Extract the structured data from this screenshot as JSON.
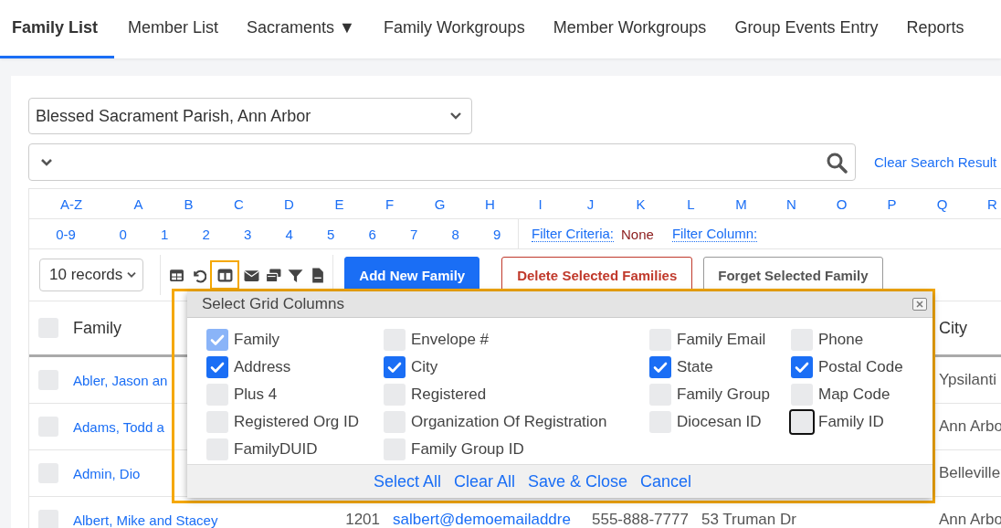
{
  "tabs": [
    {
      "label": "Family List",
      "selected": true
    },
    {
      "label": "Member List",
      "selected": false
    },
    {
      "label": "Sacraments ▼",
      "selected": false
    },
    {
      "label": "Family Workgroups",
      "selected": false
    },
    {
      "label": "Member Workgroups",
      "selected": false
    },
    {
      "label": "Group Events Entry",
      "selected": false
    },
    {
      "label": "Reports",
      "selected": false
    }
  ],
  "parish_select": {
    "value": "Blessed Sacrament Parish, Ann Arbor"
  },
  "clear_search": "Clear Search Result",
  "letters": [
    "A-Z",
    "A",
    "B",
    "C",
    "D",
    "E",
    "F",
    "G",
    "H",
    "I",
    "J",
    "K",
    "L",
    "M",
    "N",
    "O",
    "P",
    "Q",
    "R"
  ],
  "digits": [
    "0-9",
    "0",
    "1",
    "2",
    "3",
    "4",
    "5",
    "6",
    "7",
    "8",
    "9"
  ],
  "filter_criteria": {
    "label": "Filter Criteria:",
    "value": "None"
  },
  "filter_column": {
    "label": "Filter Column:"
  },
  "records_select": {
    "value": "10 records"
  },
  "tools": [
    {
      "highlighted": false
    },
    {
      "highlighted": false
    },
    {
      "highlighted": true
    },
    {
      "highlighted": false
    },
    {
      "highlighted": false
    },
    {
      "highlighted": false
    },
    {
      "highlighted": false
    }
  ],
  "buttons": [
    {
      "label": "Add New Family",
      "kind": "primary"
    },
    {
      "label": "Delete Selected Families",
      "kind": "danger"
    },
    {
      "label": "Forget Selected Family",
      "kind": "plain"
    }
  ],
  "table": {
    "select_all_checked": false,
    "columns": [
      "Family",
      "City"
    ],
    "rows": [
      {
        "checked": false,
        "family": "Abler, Jason an",
        "city": "Ypsilanti"
      },
      {
        "checked": false,
        "family": "Adams, Todd a",
        "city": "Ann Arbo"
      },
      {
        "checked": false,
        "family": "Admin, Dio",
        "city": "Belleville"
      },
      {
        "checked": false,
        "family": "Albert, Mike and Stacey",
        "column_3": "1201",
        "column_4": "salbert@demoemailaddre",
        "column_5": "555-888-7777",
        "column_6": "53 Truman Dr",
        "city": "Ann Arbo"
      }
    ]
  },
  "popup": {
    "title": "Select Grid Columns",
    "columns": [
      [
        {
          "label": "Family",
          "checked": true,
          "disabled": true,
          "focused": false
        },
        {
          "label": "Address",
          "checked": true,
          "disabled": false,
          "focused": false
        },
        {
          "label": "Plus 4",
          "checked": false,
          "disabled": false,
          "focused": false
        },
        {
          "label": "Registered Org ID",
          "checked": false,
          "disabled": false,
          "focused": false
        },
        {
          "label": "FamilyDUID",
          "checked": false,
          "disabled": false,
          "focused": false
        }
      ],
      [
        {
          "label": "Envelope #",
          "checked": false,
          "disabled": false,
          "focused": false
        },
        {
          "label": "City",
          "checked": true,
          "disabled": false,
          "focused": false
        },
        {
          "label": "Registered",
          "checked": false,
          "disabled": false,
          "focused": false
        },
        {
          "label": "Organization Of Registration",
          "checked": false,
          "disabled": false,
          "focused": false
        },
        {
          "label": "Family Group ID",
          "checked": false,
          "disabled": false,
          "focused": false
        }
      ],
      [
        {
          "label": "Family Email",
          "checked": false,
          "disabled": false,
          "focused": false
        },
        {
          "label": "State",
          "checked": true,
          "disabled": false,
          "focused": false
        },
        {
          "label": "Family Group",
          "checked": false,
          "disabled": false,
          "focused": false
        },
        {
          "label": "Diocesan ID",
          "checked": false,
          "disabled": false,
          "focused": false
        }
      ],
      [
        {
          "label": "Phone",
          "checked": false,
          "disabled": false,
          "focused": false
        },
        {
          "label": "Postal Code",
          "checked": true,
          "disabled": false,
          "focused": false
        },
        {
          "label": "Map Code",
          "checked": false,
          "disabled": false,
          "focused": false
        },
        {
          "label": "Family ID",
          "checked": false,
          "disabled": false,
          "focused": true
        }
      ]
    ],
    "actions": [
      "Select All",
      "Clear All",
      "Save & Close",
      "Cancel"
    ]
  }
}
